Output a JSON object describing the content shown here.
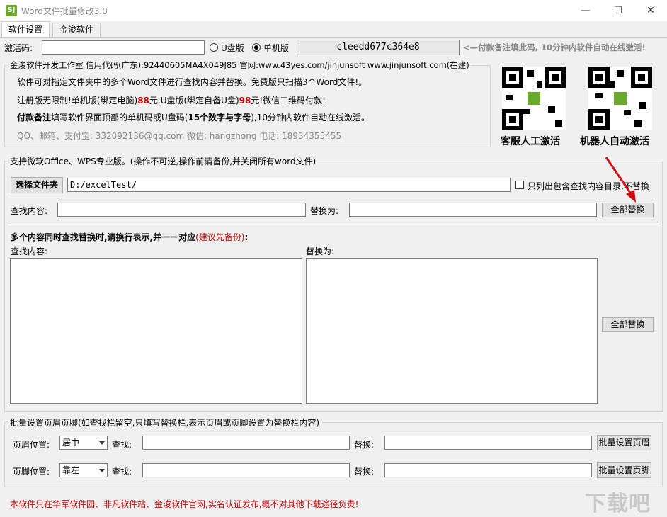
{
  "window": {
    "title": "Word文件批量修改3.0",
    "icon_text": "SJ"
  },
  "tabs": [
    {
      "label": "软件设置"
    },
    {
      "label": "金浚软件"
    }
  ],
  "activation": {
    "label": "激活码:",
    "code_value": "",
    "usb_label": "U盘版",
    "pc_label": "单机版",
    "selected": "单机版",
    "machine_code": "cleedd677c364e8",
    "note": "<—付款备注填此码, 10分钟内软件自动在线激活!"
  },
  "info": {
    "legend": "金浚软件开发工作室 信用代码(广东):92440605MA4X049J85 官网:www.43yes.com/jinjunsoft  www.jinjunsoft.com(在建)",
    "line1": "软件可对指定文件夹中的多个Word文件进行查找内容并替换。免费版只扫描3个Word文件!。",
    "line2_a": "注册版无限制!单机版(绑定电脑)",
    "line2_b": "88",
    "line2_c": "元,U盘版(绑定自备U盘)",
    "line2_d": "98",
    "line2_e": "元!微信二维码付款!",
    "line3_a": "付款备注",
    "line3_b": "填写软件界面顶部的单机码或U盘码(",
    "line3_c": "15个数字与字母",
    "line3_d": "),10分钟内软件自动在线激活。",
    "line4": "QQ、邮箱、支付宝: 332092136@qq.com   微信: hangzhong   电话: 18934355455",
    "qr1_caption": "客服人工激活",
    "qr2_caption": "机器人自动激活"
  },
  "main": {
    "legend": "支持微软Office、WPS专业版。(操作不可逆,操作前请备份,并关闭所有word文件)",
    "choose_folder": "选择文件夹",
    "folder_path": "D:/excelTest/",
    "only_list_label": "只列出包含查找内容目录,不替换",
    "find_label": "查找内容:",
    "find_value": "",
    "replace_label": "替换为:",
    "replace_value": "",
    "replace_all": "全部替换",
    "multi_title_a": "多个内容同时查找替换时,请换行表示,并一一对应",
    "multi_title_b": "(建议先备份)",
    "multi_title_c": ":",
    "multi_find_label": "查找内容:",
    "multi_replace_label": "替换为:",
    "multi_replace_all": "全部替换"
  },
  "headerfooter": {
    "legend": "批量设置页眉页脚(如查找栏留空,只填写替换栏,表示页眉或页脚设置为替换栏内容)",
    "header_pos_label": "页眉位置:",
    "header_pos_value": "居中",
    "footer_pos_label": "页脚位置:",
    "footer_pos_value": "靠左",
    "find_label": "查找:",
    "replace_label": "替换:",
    "set_header": "批量设置页眉",
    "set_footer": "批量设置页脚"
  },
  "footer_notice": "本软件只在华军软件园、非凡软件站、金浚软件官网,实名认证发布,概不对其他下载途径负责!",
  "watermark": "下载吧"
}
